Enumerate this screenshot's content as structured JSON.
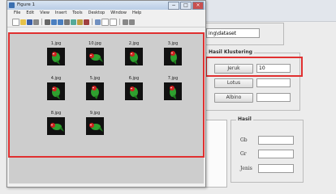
{
  "figure_window": {
    "title": "Figure 1",
    "menu": [
      "File",
      "Edit",
      "View",
      "Insert",
      "Tools",
      "Desktop",
      "Window",
      "Help"
    ],
    "images": [
      {
        "label": "1.jpg"
      },
      {
        "label": "10.jpg"
      },
      {
        "label": "2.jpg"
      },
      {
        "label": "3.jpg"
      },
      {
        "label": "4.jpg"
      },
      {
        "label": "5.jpg"
      },
      {
        "label": "6.jpg"
      },
      {
        "label": "7.jpg"
      },
      {
        "label": "8.jpg"
      },
      {
        "label": "9.jpg"
      }
    ]
  },
  "main": {
    "path_value": "ing\\dataset",
    "cluster": {
      "title": "Hasil Klustering",
      "buttons": [
        {
          "label": "Jeruk",
          "value": "10"
        },
        {
          "label": "Lotus",
          "value": ""
        },
        {
          "label": "Albino",
          "value": ""
        }
      ]
    },
    "result": {
      "title": "Hasil",
      "fields": [
        {
          "label": "Gb",
          "value": ""
        },
        {
          "label": "Gr",
          "value": ""
        },
        {
          "label": "Jenis",
          "value": ""
        }
      ]
    }
  },
  "colors": {
    "highlight": "#e03030",
    "thumbnail_bg": "#111111",
    "parrot_green": "#2fa02f",
    "parrot_red": "#d02020"
  }
}
